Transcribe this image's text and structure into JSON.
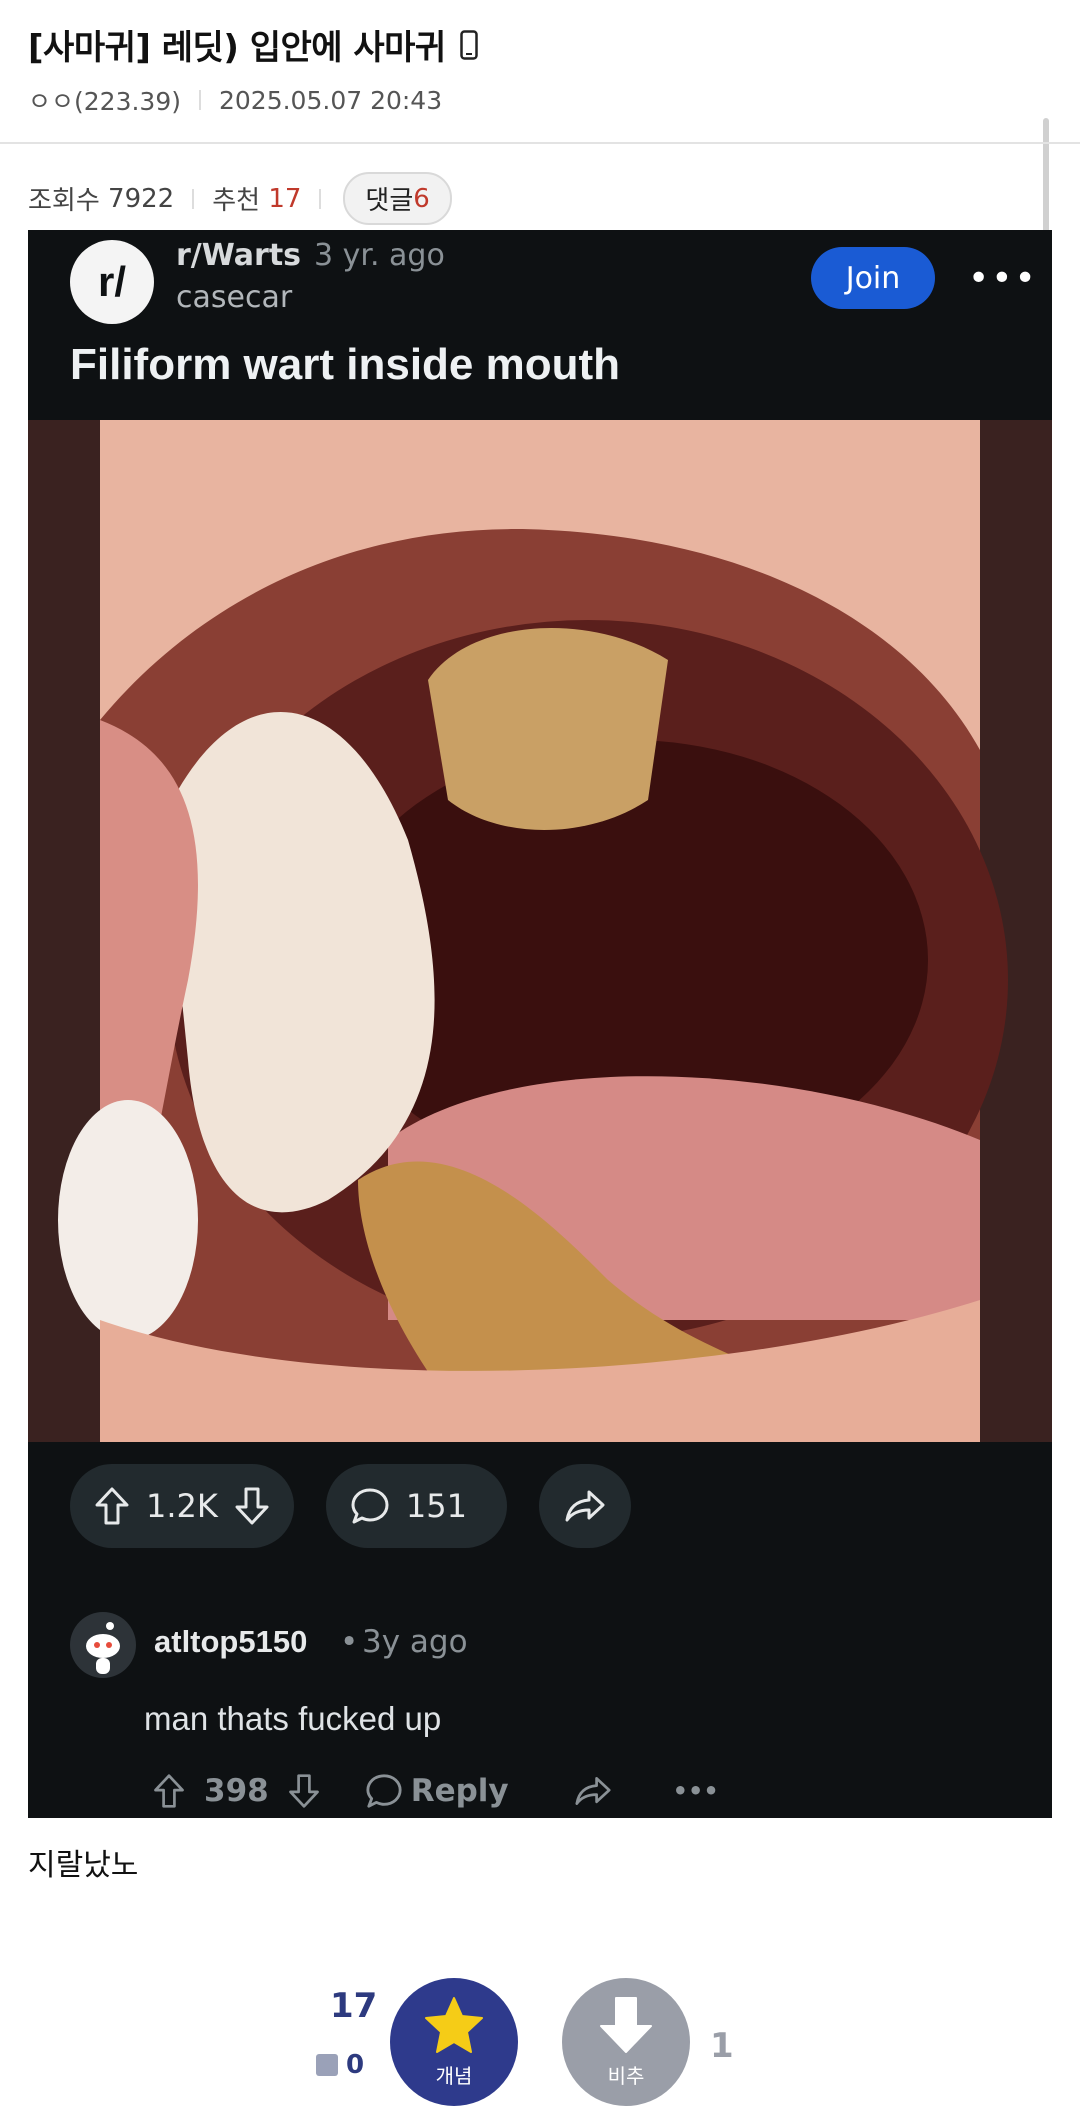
{
  "post": {
    "title": "[사마귀] 레딧) 입안에 사마귀",
    "author": "ㅇㅇ(223.39)",
    "date": "2025.05.07 20:43",
    "views_label": "조회수",
    "views": "7922",
    "recommend_label": "추천",
    "recommend_count": "17",
    "comments_label": "댓글",
    "comments_count": "6",
    "body_text": "지랄났노"
  },
  "reddit": {
    "avatar_text": "r/",
    "subreddit": "r/Warts",
    "age": "3 yr. ago",
    "username": "casecar",
    "join_label": "Join",
    "more_label": "•••",
    "post_title": "Filiform wart inside mouth",
    "score": "1.2K",
    "comment_count": "151",
    "comment": {
      "user": "atltop5150",
      "dot": "•",
      "age": "3y ago",
      "text": "man thats fucked up",
      "score": "398",
      "reply_label": "Reply",
      "more_label": "•••"
    }
  },
  "votes": {
    "up_count": "17",
    "fix_count": "0",
    "up_label": "개념",
    "down_label": "비추",
    "down_count": "1"
  },
  "colors": {
    "accent_blue": "#2e3a8c",
    "star_yellow": "#f5cc17",
    "reddit_join": "#1a5bd4",
    "reddit_bg": "#0e1113"
  }
}
